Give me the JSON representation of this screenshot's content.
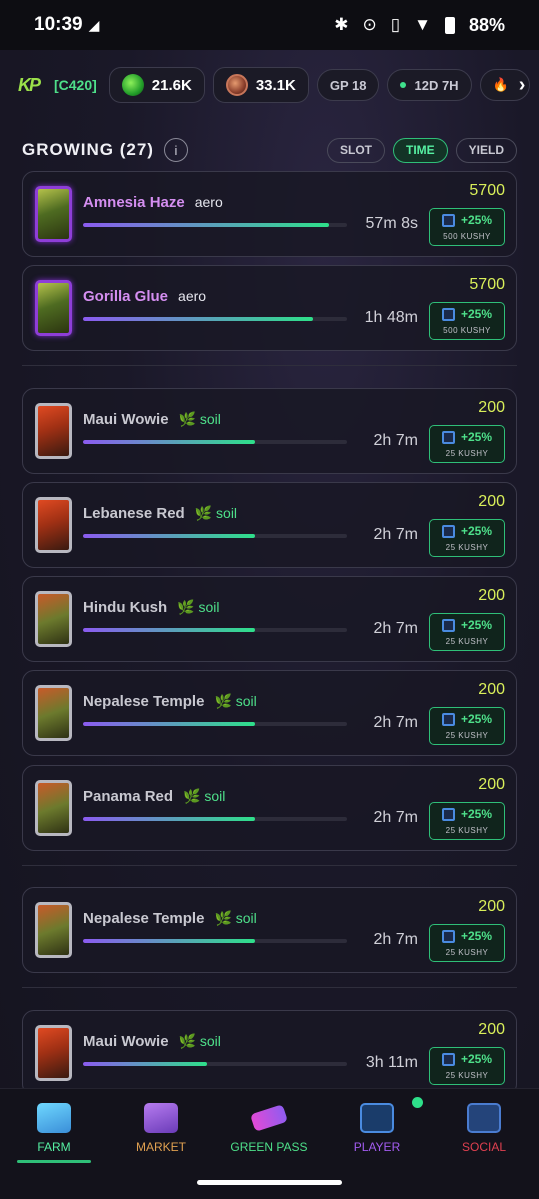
{
  "status": {
    "time": "10:39",
    "battery": "88%"
  },
  "topbar": {
    "logo": "KP",
    "clan": "[C420]",
    "green_balance": "21.6K",
    "brown_balance": "33.1K",
    "gp": "GP 18",
    "timer": "12D 7H"
  },
  "section": {
    "title": "GROWING (27)",
    "info": "i",
    "sort": [
      "SLOT",
      "TIME",
      "YIELD"
    ],
    "active_sort": "TIME"
  },
  "plants": [
    {
      "name": "Amnesia Haze",
      "medium": "aero",
      "time": "57m 8s",
      "yield": "5700",
      "boost": "+25%",
      "boost_amount": "500  KUSHY",
      "progress": 0.93
    },
    {
      "name": "Gorilla Glue",
      "medium": "aero",
      "time": "1h 48m",
      "yield": "5700",
      "boost": "+25%",
      "boost_amount": "500  KUSHY",
      "progress": 0.87
    },
    {
      "name": "Maui Wowie",
      "medium": "🌿 soil",
      "time": "2h 7m",
      "yield": "200",
      "boost": "+25%",
      "boost_amount": "25  KUSHY",
      "progress": 0.65
    },
    {
      "name": "Lebanese Red",
      "medium": "🌿 soil",
      "time": "2h 7m",
      "yield": "200",
      "boost": "+25%",
      "boost_amount": "25  KUSHY",
      "progress": 0.65
    },
    {
      "name": "Hindu Kush",
      "medium": "🌿 soil",
      "time": "2h 7m",
      "yield": "200",
      "boost": "+25%",
      "boost_amount": "25  KUSHY",
      "progress": 0.65
    },
    {
      "name": "Nepalese Temple",
      "medium": "🌿 soil",
      "time": "2h 7m",
      "yield": "200",
      "boost": "+25%",
      "boost_amount": "25  KUSHY",
      "progress": 0.65
    },
    {
      "name": "Panama Red",
      "medium": "🌿 soil",
      "time": "2h 7m",
      "yield": "200",
      "boost": "+25%",
      "boost_amount": "25  KUSHY",
      "progress": 0.65
    },
    {
      "name": "Nepalese Temple",
      "medium": "🌿 soil",
      "time": "2h 7m",
      "yield": "200",
      "boost": "+25%",
      "boost_amount": "25  KUSHY",
      "progress": 0.65
    },
    {
      "name": "Maui Wowie",
      "medium": "🌿 soil",
      "time": "3h 11m",
      "yield": "200",
      "boost": "+25%",
      "boost_amount": "25  KUSHY",
      "progress": 0.47
    }
  ],
  "nav": [
    "FARM",
    "MARKET",
    "GREEN PASS",
    "PLAYER",
    "SOCIAL"
  ]
}
